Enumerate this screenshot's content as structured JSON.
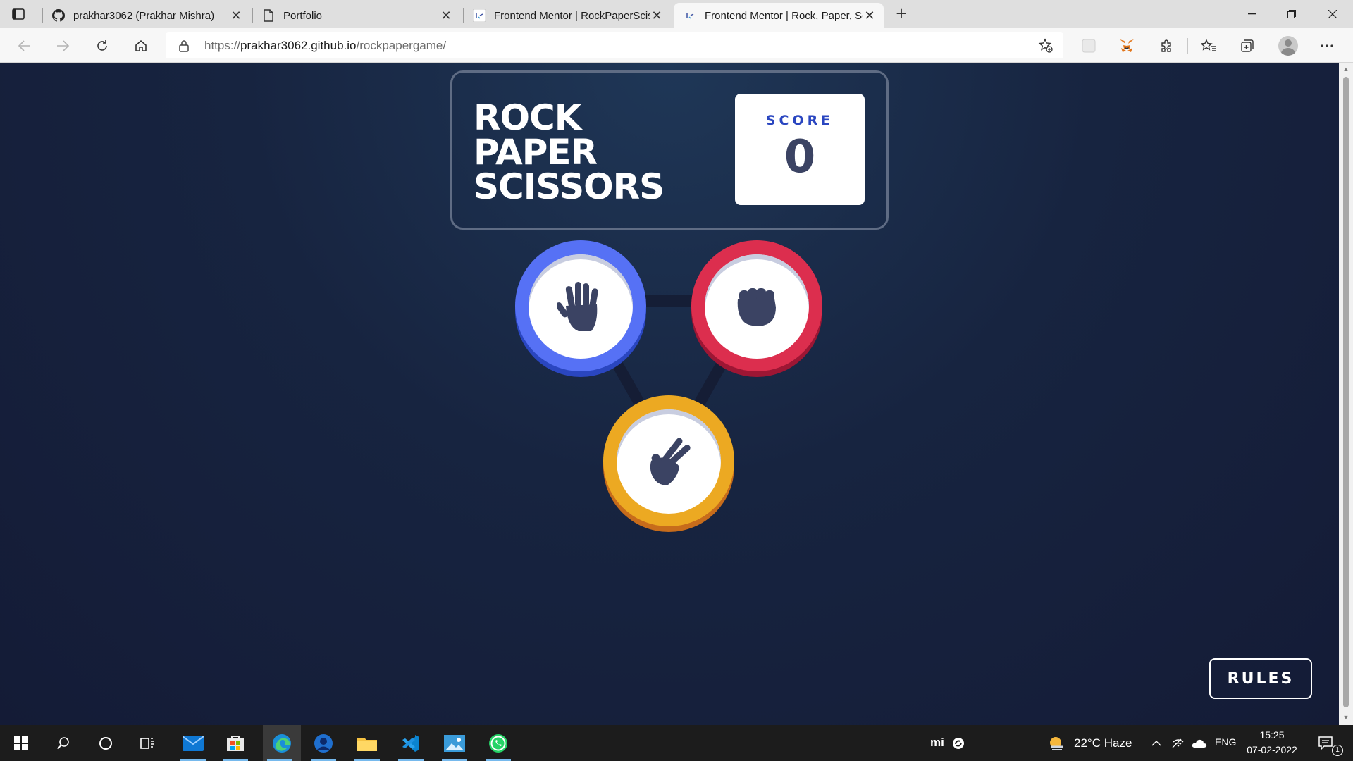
{
  "browser": {
    "tabs": [
      {
        "title": "prakhar3062 (Prakhar Mishra)",
        "favicon": "github-icon"
      },
      {
        "title": "Portfolio",
        "favicon": "page-icon"
      },
      {
        "title": "Frontend Mentor | RockPaperScissors",
        "favicon": "frontend-mentor-icon"
      },
      {
        "title": "Frontend Mentor | Rock, Paper, Scissors",
        "favicon": "frontend-mentor-icon",
        "active": true
      }
    ],
    "url_prefix": "https://",
    "url_host": "prakhar3062.github.io",
    "url_path": "/rockpapergame/"
  },
  "game": {
    "title_lines": [
      "ROCK",
      "PAPER",
      "SCISSORS"
    ],
    "score_label": "SCORE",
    "score_value": "0",
    "choices": [
      {
        "name": "paper",
        "icon": "hand-paper-icon",
        "color": "#5671f5"
      },
      {
        "name": "rock",
        "icon": "hand-rock-icon",
        "color": "#dc2e4e"
      },
      {
        "name": "scissors",
        "icon": "hand-scissors-icon",
        "color": "#eca922"
      }
    ],
    "rules_label": "RULES"
  },
  "taskbar": {
    "weather": "22°C  Haze",
    "language": "ENG",
    "time": "15:25",
    "date": "07-02-2022",
    "notification_count": "1",
    "mi_label": "mi"
  },
  "colors": {
    "background": "#1f2940",
    "paper": "#5671f5",
    "rock": "#dc2e4e",
    "scissors": "#eca922",
    "score_text": "#2a46c0"
  }
}
